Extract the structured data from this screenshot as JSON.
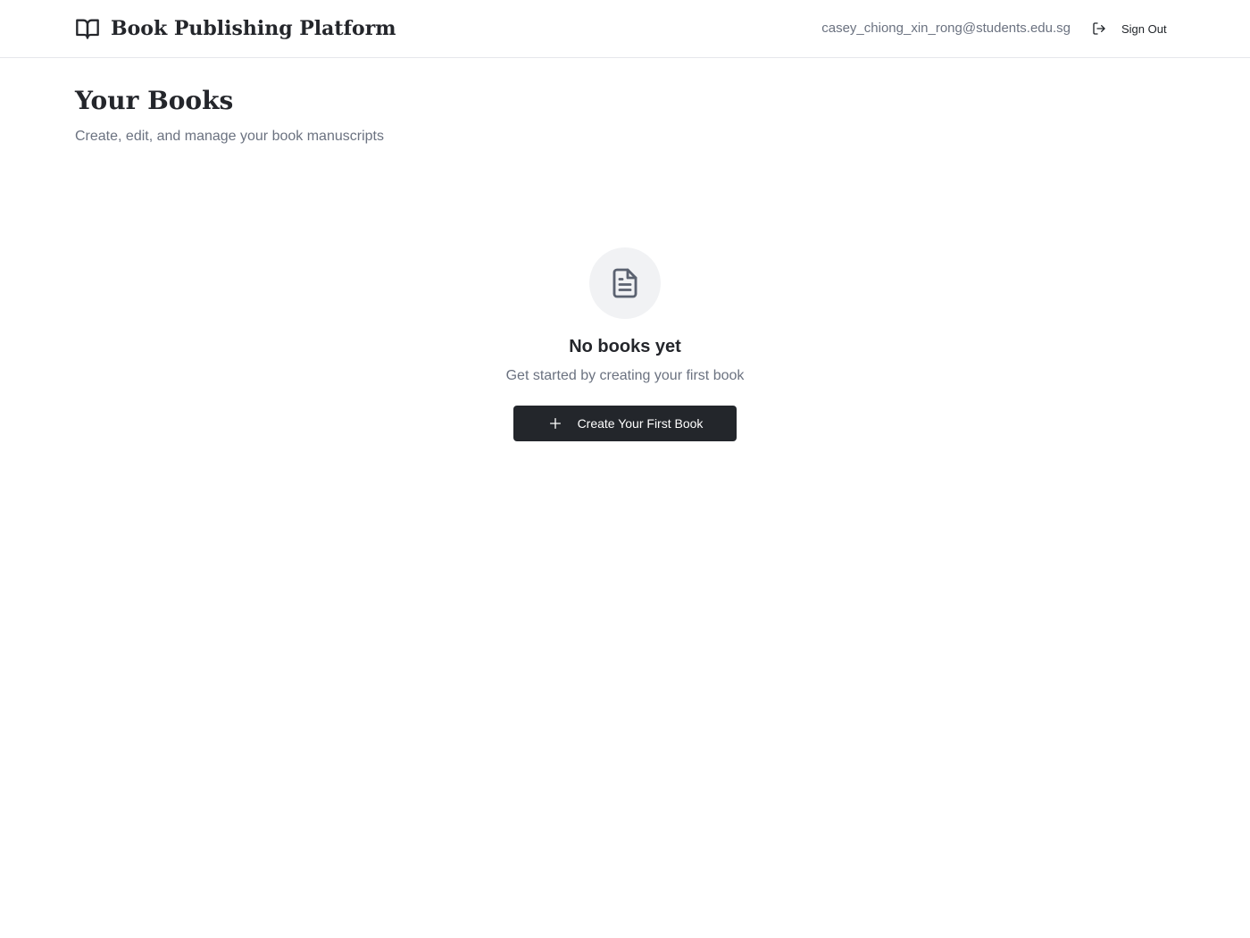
{
  "header": {
    "brand_icon": "book-open-icon",
    "brand_title": "Book Publishing Platform",
    "user_email": "casey_chiong_xin_rong@students.edu.sg",
    "signout_icon": "log-out-icon",
    "signout_label": "Sign Out"
  },
  "main": {
    "title": "Your Books",
    "subtitle": "Create, edit, and manage your book manuscripts"
  },
  "empty_state": {
    "icon": "file-text-icon",
    "title": "No books yet",
    "description": "Get started by creating your first book",
    "button_icon": "plus-icon",
    "button_label": "Create Your First Book"
  },
  "colors": {
    "primary": "#23262b",
    "muted_text": "#6b7280",
    "border": "#e5e7eb",
    "icon_bg": "#f1f2f4"
  }
}
